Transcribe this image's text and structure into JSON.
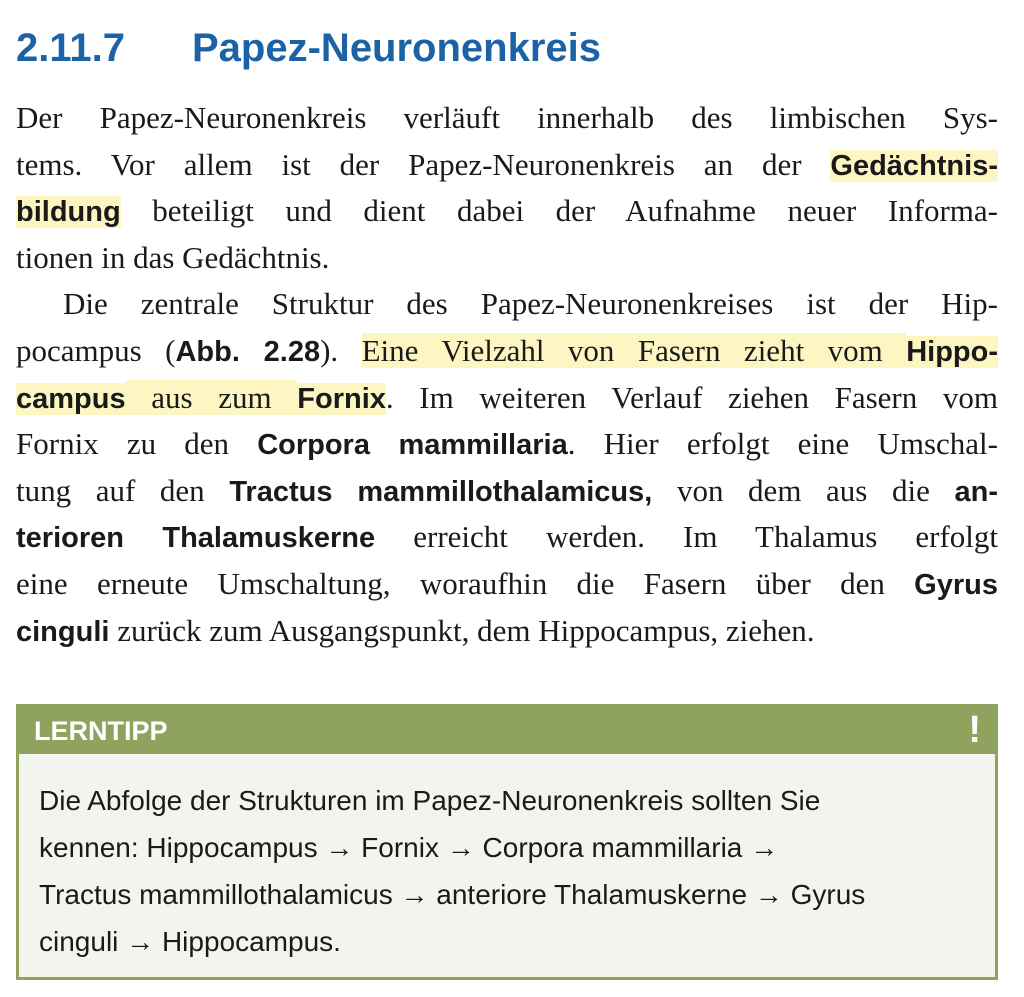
{
  "section": {
    "number": "2.11.7",
    "title": "Papez-Neuronenkreis"
  },
  "paragraph1": [
    [
      {
        "t": "Der Papez-Neuronenkreis verläuft innerhalb des limbischen Sys-"
      }
    ],
    [
      {
        "t": "tems. Vor allem ist der Papez-Neuronenkreis an der "
      },
      {
        "t": "Gedächtnis-",
        "b": true,
        "hl": true
      }
    ],
    [
      {
        "t": "bildung",
        "b": true,
        "hl": true
      },
      {
        "t": " beteiligt und dient dabei der Aufnahme neuer Informa-"
      }
    ],
    [
      {
        "t": "tionen in das Gedächtnis."
      }
    ]
  ],
  "paragraph2": [
    [
      {
        "t": "Die zentrale Struktur des Papez-Neuronenkreises ist der Hip-"
      }
    ],
    [
      {
        "t": "pocampus ("
      },
      {
        "t": "Abb. 2.28",
        "b": true
      },
      {
        "t": "). "
      },
      {
        "t": "Eine Vielzahl von Fasern zieht vom ",
        "hl": true
      },
      {
        "t": "Hippo-",
        "b": true,
        "hl": true
      }
    ],
    [
      {
        "t": "campus",
        "b": true,
        "hl": true
      },
      {
        "t": " aus zum ",
        "hl": true
      },
      {
        "t": "Fornix",
        "b": true,
        "hl": true
      },
      {
        "t": ". Im weiteren Verlauf ziehen Fasern vom"
      }
    ],
    [
      {
        "t": "Fornix zu den "
      },
      {
        "t": "Corpora mammillaria",
        "b": true
      },
      {
        "t": ". Hier erfolgt eine Umschal-"
      }
    ],
    [
      {
        "t": "tung auf den "
      },
      {
        "t": "Tractus mammillothalamicus,",
        "b": true
      },
      {
        "t": " von dem aus die "
      },
      {
        "t": "an-",
        "b": true
      }
    ],
    [
      {
        "t": "terioren Thalamuskerne",
        "b": true
      },
      {
        "t": " erreicht werden. Im Thalamus erfolgt"
      }
    ],
    [
      {
        "t": "eine erneute Umschaltung, woraufhin die Fasern über den "
      },
      {
        "t": "Gyrus",
        "b": true
      }
    ],
    [
      {
        "t": "cinguli",
        "b": true
      },
      {
        "t": " zurück zum Ausgangspunkt, dem Hippocampus, ziehen."
      }
    ]
  ],
  "lerntipp": {
    "title": "LERNTIPP",
    "icon_symbol": "!",
    "icon": "exclamation-icon",
    "lines": [
      "Die Abfolge der Strukturen im Papez-Neuronenkreis sollten Sie",
      "kennen: Hippocampus → Fornix → Corpora mammillaria →",
      "Tractus mammillothalamicus → anteriore Thalamuskerne → Gyrus",
      "cinguli → Hippocampus."
    ]
  },
  "colors": {
    "heading": "#1b63a6",
    "highlight": "#fdf6c3",
    "tip_green": "#8fa35e",
    "tip_background": "#f4f4ef"
  }
}
